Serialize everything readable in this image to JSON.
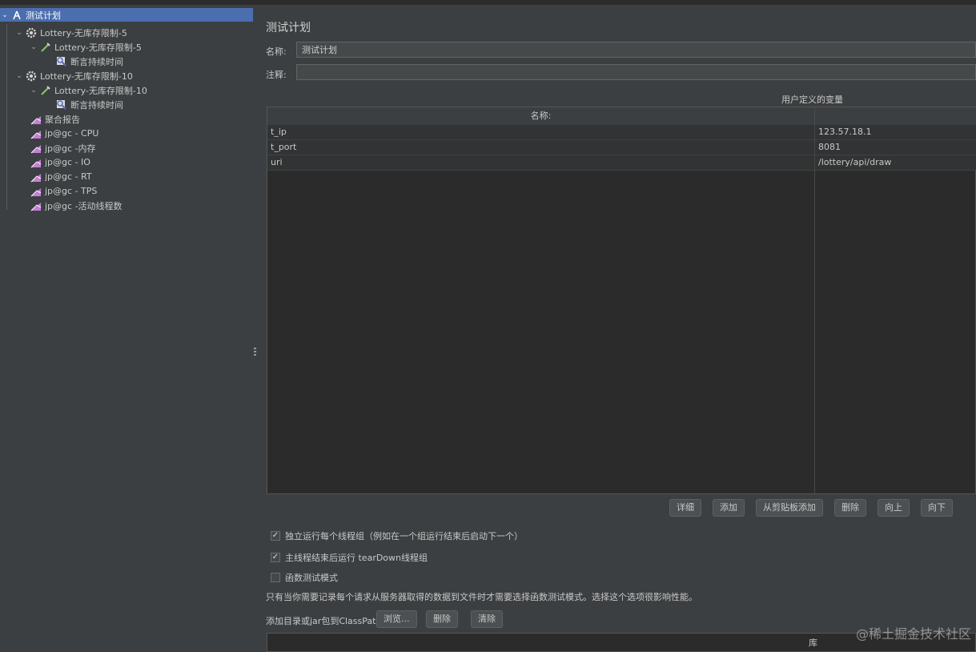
{
  "tree": {
    "items": [
      {
        "label": "测试计划"
      },
      {
        "label": "Lottery-无库存限制-5"
      },
      {
        "label": "Lottery-无库存限制-5"
      },
      {
        "label": "断言持续时间"
      },
      {
        "label": "Lottery-无库存限制-10"
      },
      {
        "label": "Lottery-无库存限制-10"
      },
      {
        "label": "断言持续时间"
      },
      {
        "label": "聚合报告"
      },
      {
        "label": "jp@gc - CPU"
      },
      {
        "label": "jp@gc -内存"
      },
      {
        "label": "jp@gc - IO"
      },
      {
        "label": "jp@gc - RT"
      },
      {
        "label": "jp@gc - TPS"
      },
      {
        "label": "jp@gc -活动线程数"
      }
    ]
  },
  "main": {
    "title": "测试计划",
    "name_label": "名称:",
    "name_value": "测试计划",
    "comment_label": "注释:",
    "comment_value": "",
    "vars_title": "用户定义的变量",
    "table": {
      "columns": [
        "名称:",
        ""
      ],
      "rows": [
        {
          "name": "t_ip",
          "value": "123.57.18.1"
        },
        {
          "name": "t_port",
          "value": "8081"
        },
        {
          "name": "uri",
          "value": "/lottery/api/draw"
        }
      ]
    },
    "buttons": {
      "detail": "详细",
      "add": "添加",
      "paste": "从剪贴板添加",
      "delete": "删除",
      "up": "向上",
      "down": "向下"
    },
    "options": {
      "independent": {
        "label": "独立运行每个线程组（例如在一个组运行结束后启动下一个）",
        "checked": true
      },
      "teardown": {
        "label": "主线程结束后运行 tearDown线程组",
        "checked": true
      },
      "functional": {
        "label": "函数测试模式",
        "checked": false
      }
    },
    "note": "只有当你需要记录每个请求从服务器取得的数据到文件时才需要选择函数测试模式。选择这个选项很影响性能。",
    "classpath": {
      "label": "添加目录或jar包到ClassPath",
      "browse": "浏览...",
      "delete": "删除",
      "clear": "清除",
      "column": "库"
    }
  },
  "watermark": "@稀土掘金技术社区",
  "colors": {
    "selection": "#4b6eaf",
    "background": "#3c3f41",
    "table_bg": "#2b2b2b"
  }
}
